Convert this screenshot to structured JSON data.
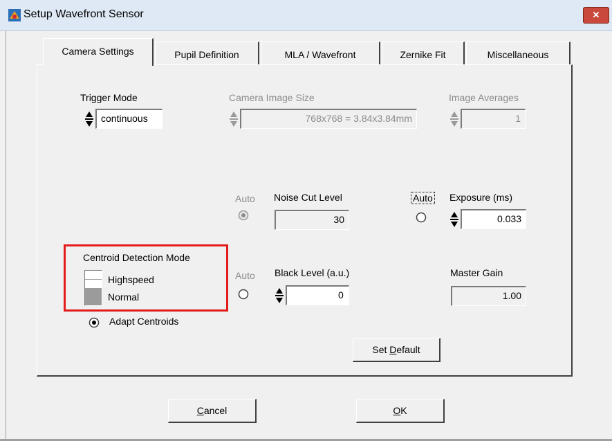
{
  "window": {
    "title": "Setup Wavefront Sensor",
    "close_glyph": "✕"
  },
  "tabs": [
    {
      "label": "Camera Settings"
    },
    {
      "label": "Pupil Definition"
    },
    {
      "label": "MLA / Wavefront"
    },
    {
      "label": "Zernike Fit"
    },
    {
      "label": "Miscellaneous"
    }
  ],
  "trigger": {
    "label": "Trigger Mode",
    "value": "continuous"
  },
  "image_size": {
    "label": "Camera Image Size",
    "value": "768x768  = 3.84x3.84mm"
  },
  "averages": {
    "label": "Image Averages",
    "value": "1"
  },
  "noise": {
    "auto_label": "Auto",
    "label": "Noise Cut Level",
    "value": "30"
  },
  "exposure": {
    "auto_label": "Auto",
    "label": "Exposure (ms)",
    "value": "0.033"
  },
  "centroid": {
    "label": "Centroid Detection Mode",
    "options": [
      "Highspeed",
      "Normal"
    ],
    "selected": "Normal"
  },
  "black": {
    "auto_label": "Auto",
    "label": "Black Level (a.u.)",
    "value": "0"
  },
  "gain": {
    "label": "Master Gain",
    "value": "1.00"
  },
  "adapt": {
    "label": "Adapt Centroids"
  },
  "buttons": {
    "set_default_pre": "Set ",
    "set_default_u": "D",
    "set_default_post": "efault",
    "cancel_u": "C",
    "cancel_post": "ancel",
    "ok_u": "O",
    "ok_post": "K"
  },
  "colors": {
    "highlight": "#e41b1b"
  }
}
